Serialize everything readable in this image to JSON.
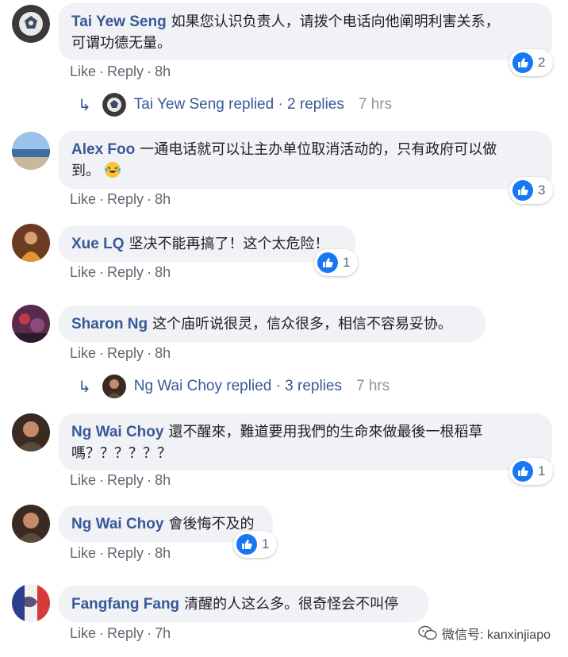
{
  "comments": [
    {
      "author": "Tai Yew Seng",
      "line1": "如果您认识负责人，请拨个电话向他阐明利害关系，",
      "line2": "可谓功德无量。",
      "like": "Like",
      "reply": "Reply",
      "time": "8h",
      "reactions": "2"
    },
    {
      "author": "Alex Foo",
      "line1": "一通电话就可以让主办单位取消活动的，只有政府可以做",
      "line2": "到。",
      "emoji": "laughing-with-tears-emoji",
      "like": "Like",
      "reply": "Reply",
      "time": "8h",
      "reactions": "3"
    },
    {
      "author": "Xue LQ",
      "line1": "坚决不能再搞了！这个太危险！",
      "like": "Like",
      "reply": "Reply",
      "time": "8h",
      "reactions": "1"
    },
    {
      "author": "Sharon Ng",
      "line1": "这个庙听说很灵，信众很多，相信不容易妥协。",
      "like": "Like",
      "reply": "Reply",
      "time": "8h"
    },
    {
      "author": "Ng Wai Choy",
      "line1": "還不醒來，難道要用我們的生命來做最後一根稻草",
      "line2": "嗎？？？？？？",
      "like": "Like",
      "reply": "Reply",
      "time": "8h",
      "reactions": "1"
    },
    {
      "author": "Ng Wai Choy",
      "line1": "會後悔不及的",
      "like": "Like",
      "reply": "Reply",
      "time": "8h",
      "reactions": "1"
    },
    {
      "author": "Fangfang Fang",
      "line1": "清醒的人这么多。很奇怪会不叫停",
      "like": "Like",
      "reply": "Reply",
      "time": "7h"
    }
  ],
  "reply_threads": [
    {
      "text": "Tai Yew Seng replied · 2 replies",
      "time": "7 hrs"
    },
    {
      "text": "Ng Wai Choy replied · 3 replies",
      "time": "7 hrs"
    }
  ],
  "watermark": {
    "text": "微信号: kanxinjiapo"
  },
  "colors": {
    "link": "#385898",
    "bubble": "#f0f2f5",
    "like_blue": "#1877f2",
    "meta": "#606770"
  }
}
